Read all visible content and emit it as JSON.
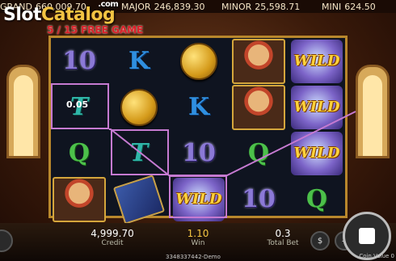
{
  "watermark": {
    "slot": "Slot",
    "catalog": "Catalog",
    "com": ".com"
  },
  "jackpots": [
    {
      "label": "GRAND",
      "value": "660,009.70"
    },
    {
      "label": "MAJOR",
      "value": "246,839.30"
    },
    {
      "label": "MINOR",
      "value": "25,598.71"
    },
    {
      "label": "MINI",
      "value": "624.50"
    }
  ],
  "free_game_banner": "5 / 15 FREE GAME",
  "reels": [
    [
      "10",
      "T",
      "Q",
      "portrait"
    ],
    [
      "K",
      "coin",
      "T",
      "book"
    ],
    [
      "coin",
      "K",
      "10",
      "WILD"
    ],
    [
      "portrait",
      "portrait",
      "Q",
      "10"
    ],
    [
      "WILD",
      "WILD",
      "WILD",
      "Q"
    ]
  ],
  "win_on_symbol": "0.05",
  "hud": {
    "credit_value": "4,999.70",
    "credit_label": "Credit",
    "win_value": "1.10",
    "win_label": "Win",
    "bet_value": "0.3",
    "bet_label": "Total Bet"
  },
  "round_id": "3348337442-Demo",
  "coin_value_label": "Coin Value 0",
  "colors": {
    "win_box": "#c67ad1",
    "reel_frame": "#b8872c",
    "win_text": "#f5c542"
  }
}
